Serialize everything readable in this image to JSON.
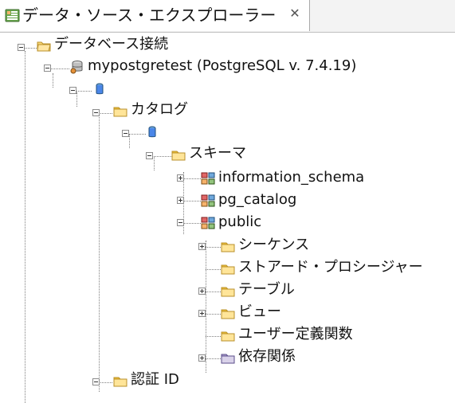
{
  "tab": {
    "title": "データ・ソース・エクスプローラー",
    "close_icon": "close-icon",
    "icon": "data-source-explorer-icon"
  },
  "tree": {
    "database_connections": "データベース接続",
    "connection": "mypostgretest (PostgreSQL v. 7.4.19)",
    "catalogs": "カタログ",
    "schemas": "スキーマ",
    "schema_information": "information_schema",
    "schema_pg_catalog": "pg_catalog",
    "schema_public": "public",
    "sequences": "シーケンス",
    "stored_procedures": "ストアード・プロシージャー",
    "tables": "テーブル",
    "views": "ビュー",
    "udfs": "ユーザー定義関数",
    "dependencies": "依存関係",
    "authorization_ids": "認証 ID"
  },
  "icons": {
    "database_connections": "folder-open-icon",
    "connection": "database-connection-icon",
    "db": "database-icon",
    "folder": "folder-icon",
    "schema": "schema-icon",
    "dependencies": "dependency-folder-icon"
  }
}
